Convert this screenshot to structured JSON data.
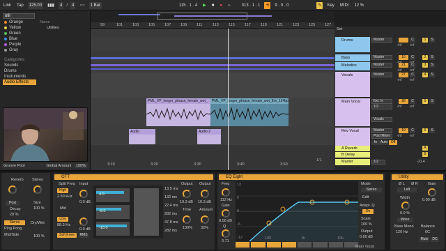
{
  "transport": {
    "link": "Link",
    "tap": "Tap",
    "tempo": "125.00",
    "sig_num": "4",
    "sig_den": "4",
    "metro": "○○",
    "quantize": "1 Bar",
    "position": "115 . 1 . 4",
    "loop_start": "313 . 1 . 1",
    "loop_len": "9 . 0 . 0",
    "key": "Key",
    "midi": "MIDI",
    "cpu": "12 %"
  },
  "browser": {
    "search_value": "util",
    "collections": [
      {
        "label": "Orange",
        "color": "#f28a2b"
      },
      {
        "label": "Yellow",
        "color": "#e6d64a"
      },
      {
        "label": "Green",
        "color": "#54c45a"
      },
      {
        "label": "Blue",
        "color": "#3f8fe6"
      },
      {
        "label": "Purple",
        "color": "#b65de3"
      },
      {
        "label": "Gray",
        "color": "#9b9b9b"
      }
    ],
    "categories_header": "Categories",
    "categories": [
      "Sounds",
      "Drums",
      "Instruments",
      "Audio Effects"
    ],
    "name_header": "Name",
    "items": [
      "Utilities",
      "Align Delay",
      "Audio Effect Rack",
      "CV Clock In",
      "CV Clock Out",
      "CV Utility",
      "External...o Effect",
      "Spectrum",
      "Tuner",
      "Utility"
    ],
    "groove_pool": "Groove Pool",
    "global_amount_label": "Global Amount",
    "global_amount": "100%"
  },
  "arrangement": {
    "bars": [
      "99",
      "101",
      "103",
      "105",
      "107",
      "109",
      "111",
      "113",
      "115",
      "117",
      "119",
      "121",
      "123",
      "125",
      "127"
    ],
    "times": [
      "3:10",
      "3:20",
      "3:30",
      "3:40",
      "3:50"
    ],
    "clip_long_1": "PML_VP_longer_phrase_female_wet_",
    "clip_long_2": "PML_VP_longer_phrase_female_wet_Em_124bp",
    "clip_audio_1": "Audio",
    "clip_audio_2": "Audio 2",
    "set_label": "Set",
    "page_info": "1/1"
  },
  "mixer": {
    "tracks": [
      {
        "name": "Drums",
        "color": "#8dc7ee",
        "io": "Master",
        "vol": "",
        "pan": "C",
        "num": "1"
      },
      {
        "name": "Bass",
        "color": "#8dc7ee",
        "io": "Master",
        "vol": "16",
        "pan": "C",
        "num": "2"
      },
      {
        "name": "Melodics",
        "color": "#8dc7ee",
        "io": "Master",
        "vol": "21",
        "pan": "C",
        "num": "3"
      },
      {
        "name": "Vocals",
        "color": "#d7c0ee",
        "io": "Master",
        "vol": "27",
        "pan": "C",
        "num": "4"
      },
      {
        "name": "Main Vocal",
        "color": "#d7c0ee",
        "io": "Ext. In",
        "vol": "28",
        "pan": "C",
        "num": "5"
      },
      {
        "name": "Rev Vocal",
        "color": "#d7c0ee",
        "io": "Master",
        "vol": "19",
        "pan": "C",
        "num": "6"
      }
    ],
    "main_vocal_in": "1/2",
    "main_vocal_in2": "Vocals",
    "post_mixer": "Post Mixer",
    "in": "In",
    "auto": "Auto",
    "off": "Off",
    "returns": [
      {
        "name": "A Reverb",
        "color": "#e8ef79",
        "letter": "A"
      },
      {
        "name": "B Delay",
        "color": "#e8ef79",
        "letter": "B"
      }
    ],
    "master": "Master",
    "master_vol": "1/2",
    "inf": "-inf",
    "db_val_1": "1.5",
    "db_val_2": "4.0",
    "db_val_3": "1.0",
    "sends": "Sends",
    "db_m": "-21.4"
  },
  "devices": {
    "reverb": {
      "title": "Reverb",
      "stereo": "Stereo",
      "decay": "Decay",
      "decay_val": "29 %",
      "post": "Post",
      "mode": "Ping Pong",
      "mid_side": "Mid/Side",
      "stereo_btn": "Stereo",
      "dry_wet": "Dry/Wet",
      "dry_wet_val": "100 %",
      "size": "Size",
      "size_val": "100 %"
    },
    "ott": {
      "title": "OTT",
      "split": "Split Freq",
      "input": "Input",
      "high": "High",
      "high_freq": "2.50 kHz",
      "low": "Low",
      "low_freq": "88.3 Hz",
      "mid": "Mid",
      "input_db": "0.0 dB",
      "band_vals": [
        "4.0",
        "-8.0",
        "-18.0"
      ],
      "times": [
        "13.5 ms",
        "132 ms",
        "22.4 ms",
        "282 ms",
        "47.8 ms",
        "282 ms"
      ],
      "output": "Output",
      "out_val": "10.3 dB",
      "time": "Time",
      "time_val": "100%",
      "amount": "Amount",
      "amount_val": "32%",
      "soft_knee": "Soft Knee",
      "rms": "RMS"
    },
    "eq": {
      "title": "EQ Eight",
      "freq": "Freq",
      "freq_val": "112 Hz",
      "gain": "Gain",
      "gain_val": "0.00 dB",
      "q": "Q",
      "q_val": "0.71",
      "mode": "Mode",
      "stereo": "Stereo",
      "edit": "Edit",
      "adapt_q": "Adapt. Q",
      "on": "On",
      "scale": "Scale",
      "scale_val": "100 %",
      "output": "Output",
      "out_val": "0.00 dB",
      "db_ticks": [
        "12",
        "6",
        "0",
        "-6",
        "-12"
      ],
      "freq_ticks": [
        "100",
        "1k",
        "10k"
      ]
    },
    "utility": {
      "title": "Utility",
      "phase_l": "Ø L",
      "phase_r": "Ø R",
      "left": "Left",
      "gain": "Gain",
      "gain_val": "0.00 dB",
      "width": "Width",
      "width_val": "0.0 %",
      "mono": "Mono",
      "bass_mono": "Bass Mono",
      "bass_freq": "120 Hz",
      "balance": "Balance",
      "balance_val": "0C",
      "mute": "Mute",
      "dc": "DC"
    },
    "footer_track": "Main Vocal"
  }
}
